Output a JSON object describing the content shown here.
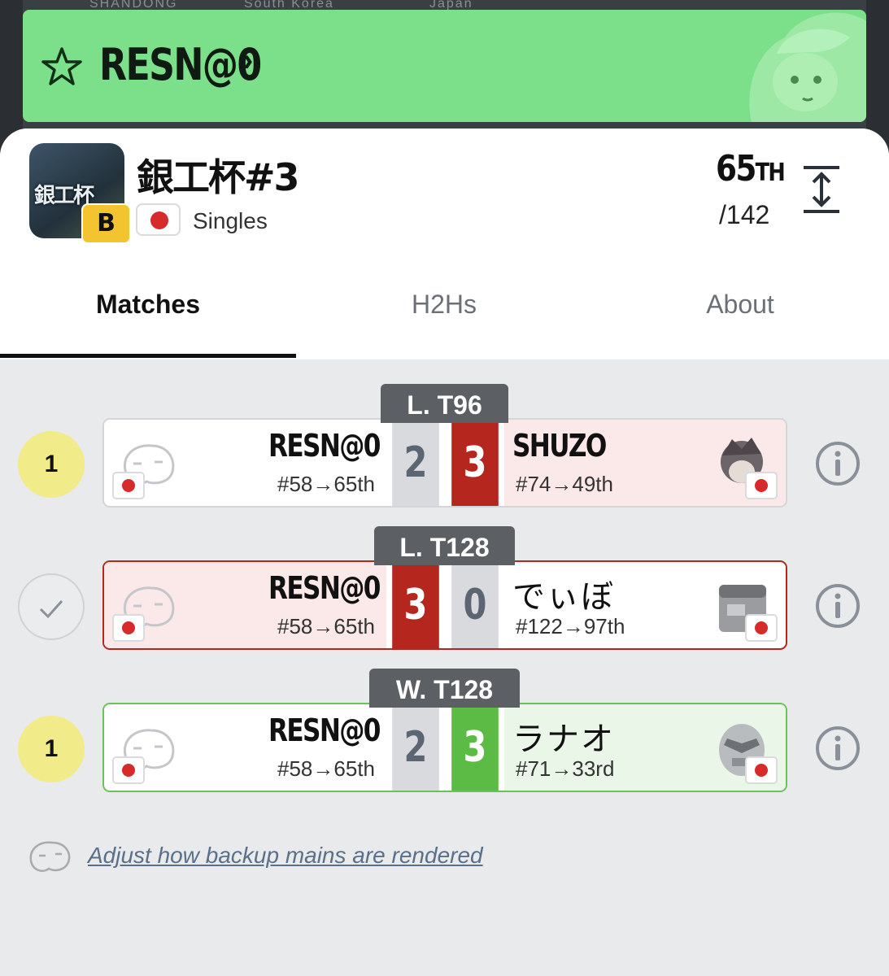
{
  "map": {
    "labels": [
      "SHANDONG",
      "South Korea",
      "Japan"
    ]
  },
  "banner": {
    "player_name": "RESN@0",
    "chevron": "›",
    "icons": [
      "star-icon",
      "character-art"
    ]
  },
  "event": {
    "title": "銀工杯#3",
    "thumb_text": "銀工杯",
    "tier": "B",
    "type": "Singles",
    "placing_number": "65",
    "placing_suffix": "TH",
    "entrants": "/142"
  },
  "tabs": [
    {
      "label": "Matches",
      "active": true
    },
    {
      "label": "H2Hs",
      "active": false
    },
    {
      "label": "About",
      "active": false
    }
  ],
  "matches": [
    {
      "round": "L. T96",
      "status": "1",
      "player1": {
        "name": "RESN@0",
        "seed": "#58→65th"
      },
      "player2": {
        "name": "SHUZO",
        "seed": "#74→49th"
      },
      "score1": "2",
      "score2": "3"
    },
    {
      "round": "L. T128",
      "status": "",
      "player1": {
        "name": "RESN@0",
        "seed": "#58→65th"
      },
      "player2": {
        "name": "でぃぼ",
        "seed": "#122→97th"
      },
      "score1": "3",
      "score2": "0"
    },
    {
      "round": "W. T128",
      "status": "1",
      "player1": {
        "name": "RESN@0",
        "seed": "#58→65th"
      },
      "player2": {
        "name": "ラナオ",
        "seed": "#71→33rd"
      },
      "score1": "2",
      "score2": "3"
    }
  ],
  "footer": {
    "link_text": "Adjust how backup mains are rendered"
  },
  "colors": {
    "banner_green": "#7ce08b",
    "loss_red": "#b5261f",
    "win_green": "#5bbb44",
    "tier_yellow": "#f4c430",
    "status_yellow": "#f2eb8a"
  }
}
